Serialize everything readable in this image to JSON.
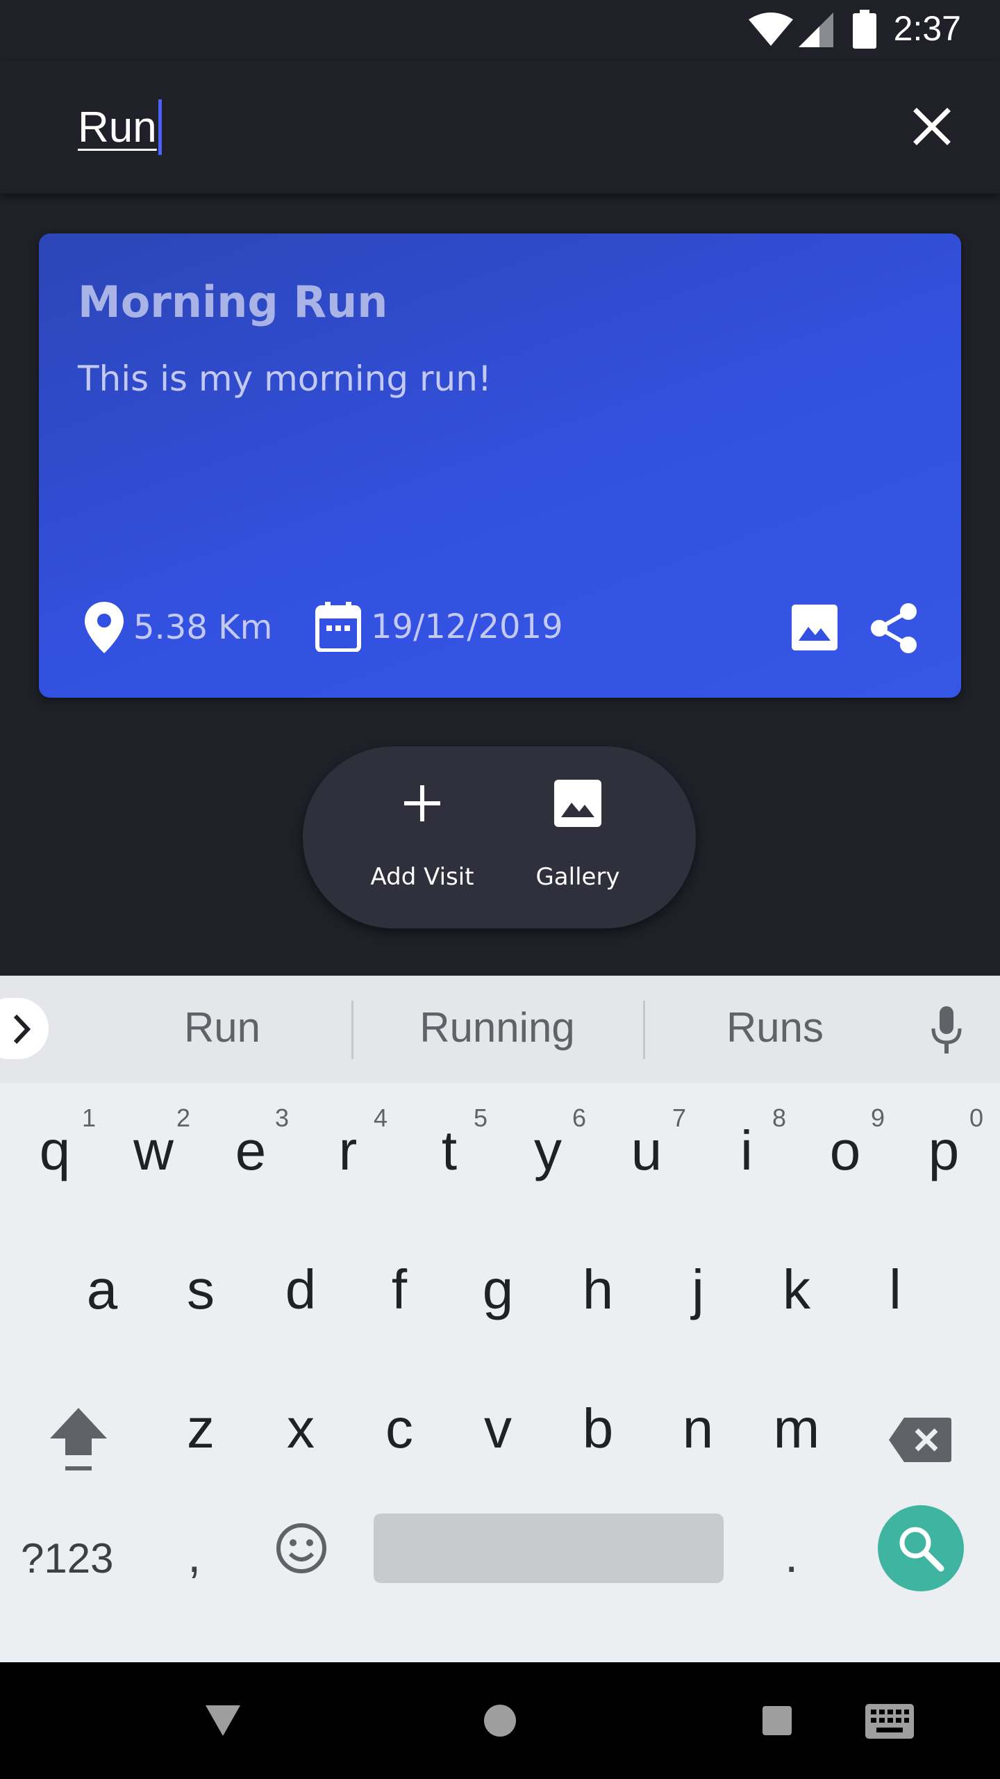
{
  "status_bar": {
    "time": "2:37",
    "icons": [
      "wifi-icon",
      "signal-icon",
      "battery-icon"
    ]
  },
  "search": {
    "query": "Run",
    "close_icon": "close-icon"
  },
  "card": {
    "title": "Morning Run",
    "description": "This is my morning run!",
    "distance": "5.38 Km",
    "date": "19/12/2019",
    "accent_color": "#3656e6"
  },
  "fab_menu": {
    "items": [
      {
        "label": "Add Visit",
        "icon": "plus-icon"
      },
      {
        "label": "Gallery",
        "icon": "image-icon"
      }
    ]
  },
  "keyboard": {
    "suggestions": [
      "Run",
      "Running",
      "Runs"
    ],
    "row1": [
      {
        "char": "q",
        "num": "1"
      },
      {
        "char": "w",
        "num": "2"
      },
      {
        "char": "e",
        "num": "3"
      },
      {
        "char": "r",
        "num": "4"
      },
      {
        "char": "t",
        "num": "5"
      },
      {
        "char": "y",
        "num": "6"
      },
      {
        "char": "u",
        "num": "7"
      },
      {
        "char": "i",
        "num": "8"
      },
      {
        "char": "o",
        "num": "9"
      },
      {
        "char": "p",
        "num": "0"
      }
    ],
    "row2": [
      "a",
      "s",
      "d",
      "f",
      "g",
      "h",
      "j",
      "k",
      "l"
    ],
    "row3": [
      "z",
      "x",
      "c",
      "v",
      "b",
      "n",
      "m"
    ],
    "symbols_label": "?123",
    "comma": ",",
    "period": ".",
    "search_key_color": "#3fb4a0"
  }
}
